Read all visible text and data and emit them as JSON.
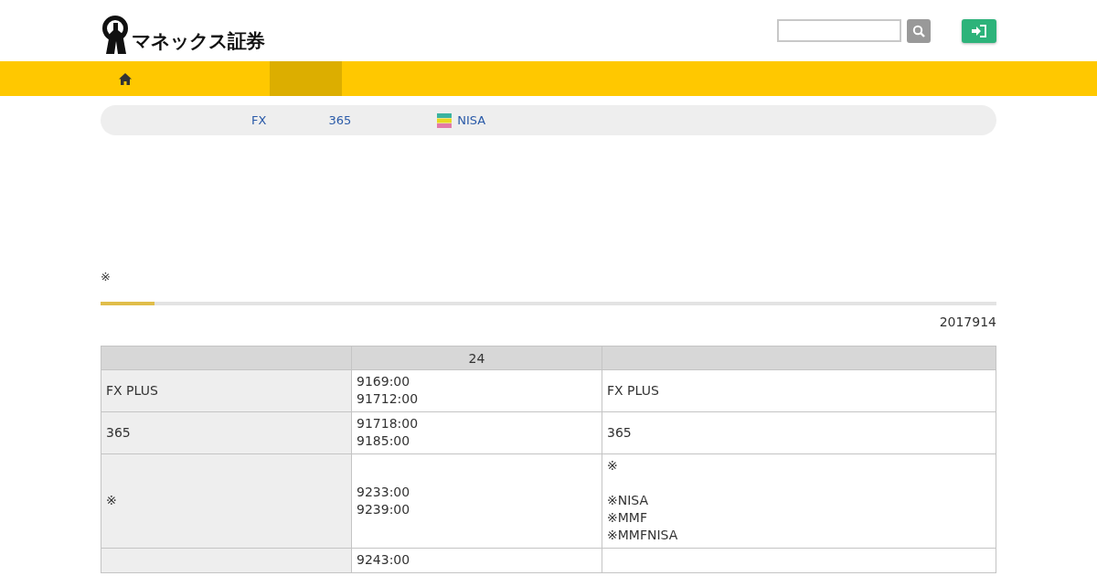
{
  "header": {
    "logo_text": "マネックス証券"
  },
  "nav": {
    "tabs": [
      {
        "kind": "home",
        "selected": false
      },
      {
        "kind": "blank",
        "selected": true
      }
    ]
  },
  "subnav": {
    "items": [
      {
        "label": "FX",
        "kind": "text"
      },
      {
        "label": "365",
        "kind": "text"
      },
      {
        "label": "NISA",
        "kind": "flag"
      }
    ]
  },
  "note": "※",
  "progress": {
    "level": 0.06
  },
  "date": "2017914",
  "table": {
    "columns": [
      "",
      "24",
      ""
    ],
    "rows": [
      {
        "cells": [
          [
            [
              "FX PLUS"
            ]
          ],
          [
            [
              "9169:00",
              "91712:00"
            ]
          ],
          [
            [
              "FX PLUS"
            ]
          ]
        ]
      },
      {
        "cells": [
          [
            [
              "365"
            ]
          ],
          [
            [
              "91718:00",
              "9185:00"
            ]
          ],
          [
            [
              "365"
            ]
          ]
        ]
      },
      {
        "cells": [
          [
            [
              "※"
            ]
          ],
          [
            [
              "9233:00",
              "9239:00"
            ]
          ],
          [
            [
              "※"
            ],
            [
              "※NISA",
              "※MMF",
              "※MMFNISA"
            ]
          ]
        ]
      },
      {
        "cells": [
          [],
          [
            [
              "9243:00"
            ]
          ],
          []
        ]
      }
    ]
  }
}
